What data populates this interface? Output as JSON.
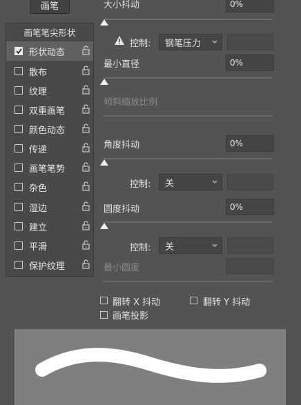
{
  "brush_button": "画笔",
  "brush_tip_shape": "画笔笔尖形状",
  "options": [
    {
      "label": "形状动态",
      "checked": true
    },
    {
      "label": "散布",
      "checked": false
    },
    {
      "label": "纹理",
      "checked": false
    },
    {
      "label": "双重画笔",
      "checked": false
    },
    {
      "label": "颜色动态",
      "checked": false
    },
    {
      "label": "传递",
      "checked": false
    },
    {
      "label": "画笔笔势",
      "checked": false
    },
    {
      "label": "杂色",
      "checked": false
    },
    {
      "label": "湿边",
      "checked": false
    },
    {
      "label": "建立",
      "checked": false
    },
    {
      "label": "平滑",
      "checked": false
    },
    {
      "label": "保护纹理",
      "checked": false
    }
  ],
  "size_jitter": {
    "label": "大小抖动",
    "value": "0%"
  },
  "control1": {
    "label": "控制:",
    "value": "钢笔压力",
    "warning_icon": "warning-icon"
  },
  "min_diameter": {
    "label": "最小直径",
    "value": "0%"
  },
  "tilt_scale": {
    "label": "倾斜缩放比例"
  },
  "angle_jitter": {
    "label": "角度抖动",
    "value": "0%"
  },
  "control2": {
    "label": "控制:",
    "value": "关"
  },
  "roundness_jitter": {
    "label": "圆度抖动",
    "value": "0%"
  },
  "control3": {
    "label": "控制:",
    "value": "关"
  },
  "min_roundness": {
    "label": "最小圆度"
  },
  "flip_x": {
    "label": "翻转 X 抖动",
    "checked": false
  },
  "flip_y": {
    "label": "翻转 Y 抖动",
    "checked": false
  },
  "brush_projection": {
    "label": "画笔投影",
    "checked": false
  },
  "colors": {
    "bg": "#535353",
    "panel": "#494949",
    "stroke": "#ffffff"
  }
}
